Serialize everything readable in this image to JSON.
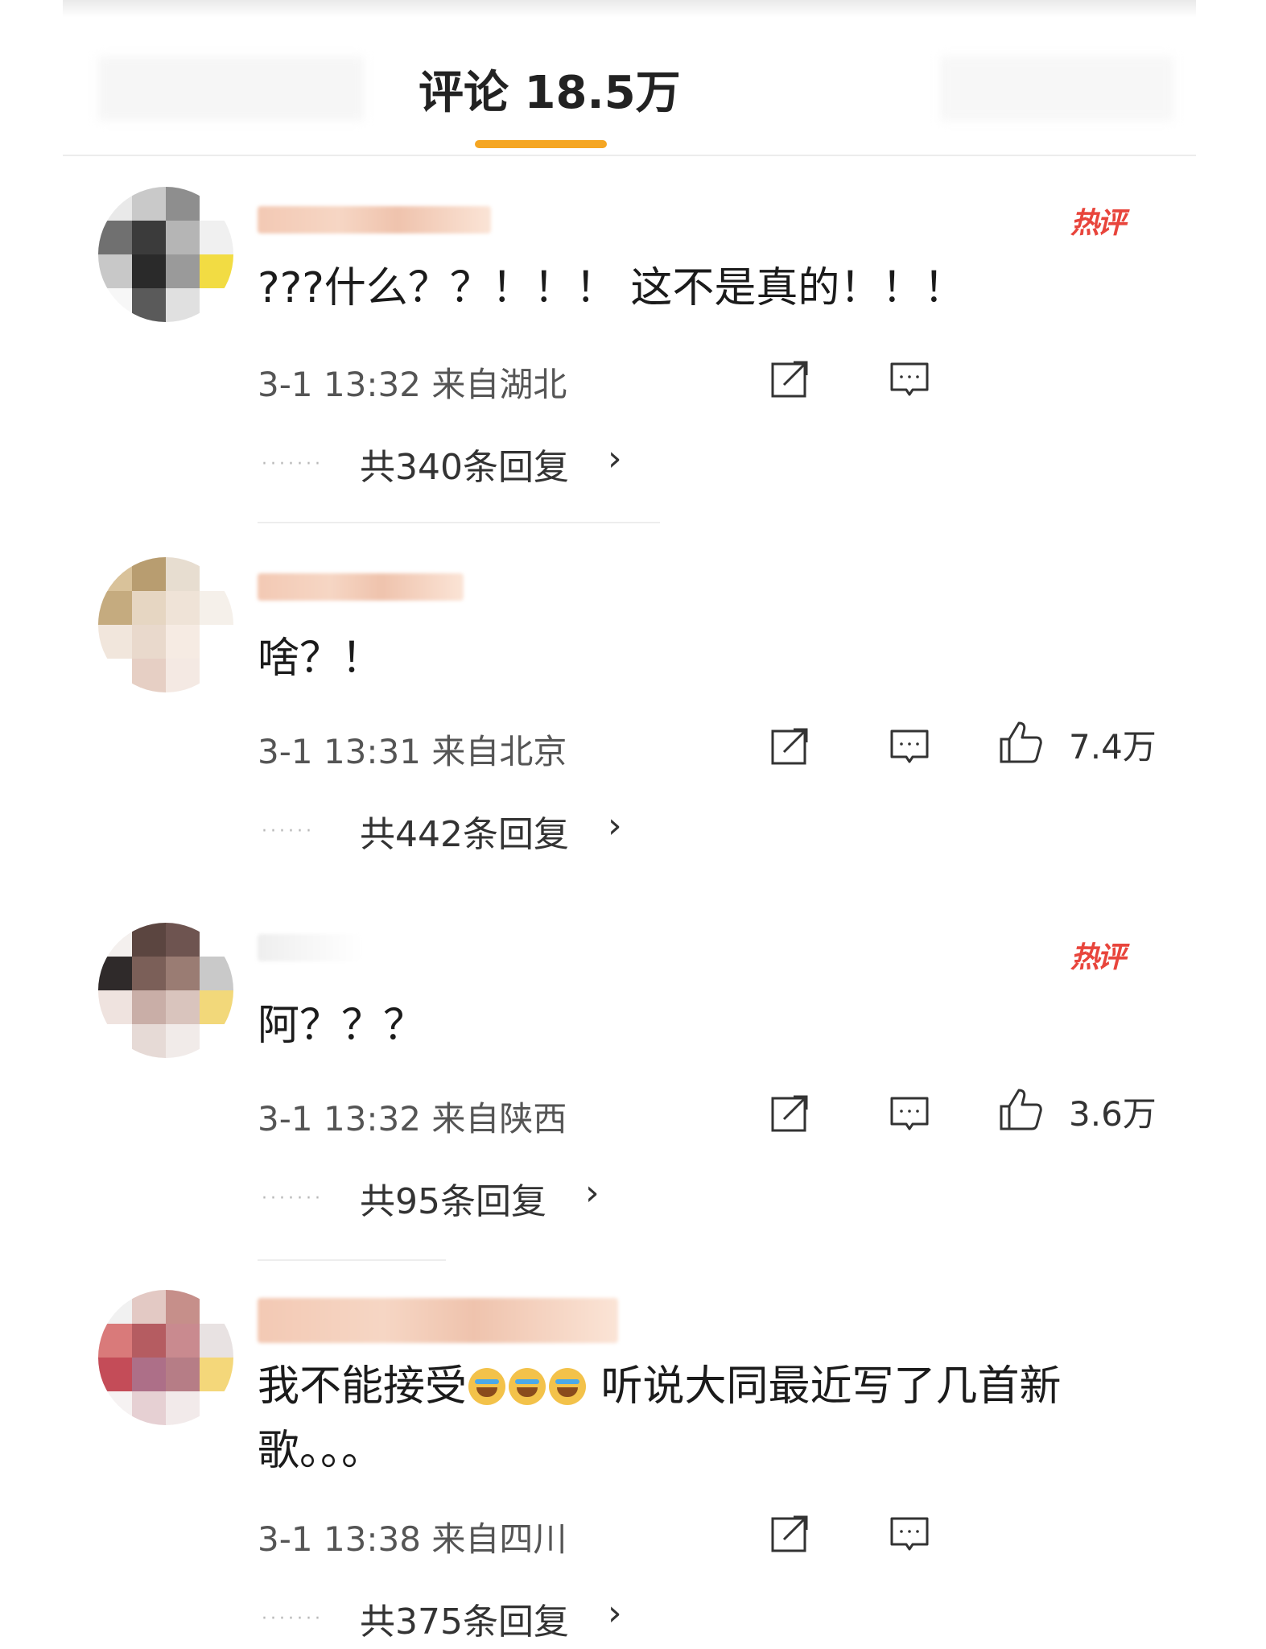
{
  "tab": {
    "title": "评论 18.5万"
  },
  "comments": [
    {
      "hot_label": "热评",
      "text": "???什么？？！！！ 这不是真的！！！",
      "meta": "3-1 13:32 来自湖北",
      "likes": "",
      "replies": "共340条回复",
      "avatar_colors": [
        "#e9e9e9",
        "#c9c9c9",
        "#8e8e8e",
        "#ffffff",
        "#707070",
        "#3b3b3b",
        "#b5b5b5",
        "#f0f0f0",
        "#c8c8c8",
        "#2a2a2a",
        "#9a9a9a",
        "#f2dc43",
        "#f7f7f7",
        "#5a5a5a",
        "#e0e0e0",
        "#ffffff"
      ]
    },
    {
      "hot_label": "",
      "text": "啥？！",
      "meta": "3-1 13:31 来自北京",
      "likes": "7.4万",
      "replies": "共442条回复",
      "avatar_colors": [
        "#d9c29a",
        "#b89d70",
        "#e7ddd0",
        "#ffffff",
        "#c5ab7f",
        "#e6d6c2",
        "#efe3d7",
        "#f5f0ea",
        "#f1e6dc",
        "#e9d9cc",
        "#f6ebe3",
        "#ffffff",
        "#ffffff",
        "#e6cfc4",
        "#f4e9e3",
        "#ffffff"
      ]
    },
    {
      "hot_label": "热评",
      "text": "阿？？？",
      "meta": "3-1 13:32 来自陕西",
      "likes": "3.6万",
      "replies": "共95条回复",
      "avatar_colors": [
        "#f4f0ee",
        "#5b4540",
        "#6e5450",
        "#ffffff",
        "#2f2a2a",
        "#7b5f58",
        "#9a7c73",
        "#c9c9c9",
        "#efe3df",
        "#c9aea7",
        "#d9c4bd",
        "#f2d87a",
        "#ffffff",
        "#e6dad6",
        "#f1ebe9",
        "#ffffff"
      ]
    },
    {
      "hot_label": "",
      "text_before": "我不能接受",
      "text_after": " 听说大同最近写了几首新歌。。。",
      "emoji_names": [
        "crying-emoji",
        "crying-emoji",
        "crying-emoji"
      ],
      "meta": "3-1 13:38 来自四川",
      "likes": "",
      "replies": "共375条回复",
      "avatar_colors": [
        "#f1f1f1",
        "#e3c9c4",
        "#c68f8a",
        "#ffffff",
        "#d97a7a",
        "#b55c61",
        "#c98a8f",
        "#e8e2e2",
        "#c44c58",
        "#ad6f88",
        "#b67d86",
        "#f4d77a",
        "#f6f2f2",
        "#e6d0d3",
        "#f2eaea",
        "#ffffff"
      ]
    }
  ],
  "icons": {
    "share": "share-icon",
    "comment": "comment-icon",
    "like": "thumbs-up-icon",
    "chevron": "chevron-right-icon"
  },
  "colors": {
    "accent_underline": "#f5a623",
    "hot_label": "#e8453c"
  }
}
